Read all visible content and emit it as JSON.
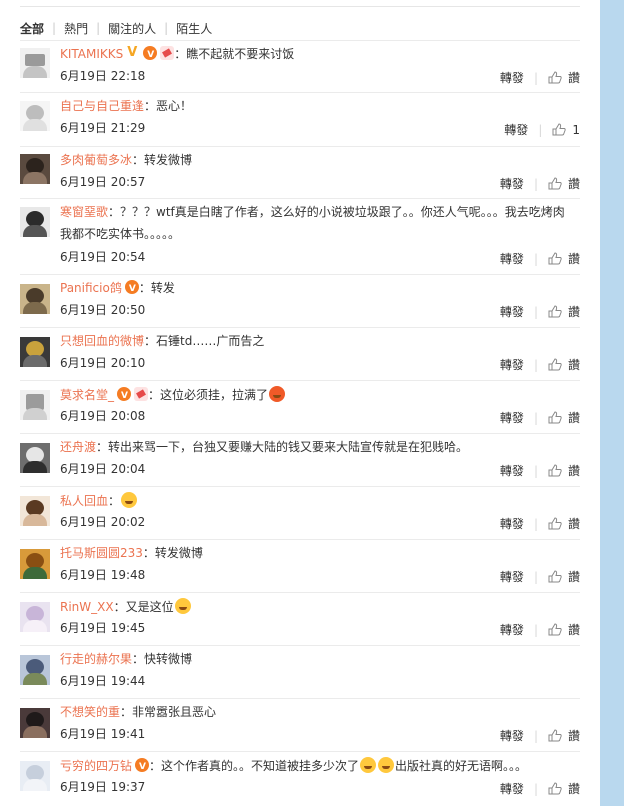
{
  "filter": {
    "tabs": [
      "全部",
      "熱門",
      "關注的人",
      "陌生人"
    ]
  },
  "comments": [
    {
      "name": "KITAMIKKS",
      "text": "：瞧不起就不要来讨饭",
      "date": "6月19日 22:18",
      "repost": "轉發",
      "reply": "讚"
    },
    {
      "name": "自己与自己重逢",
      "text": "：恶心！",
      "date": "6月19日 21:29",
      "repost": "轉發",
      "reply": "1"
    },
    {
      "name": "多肉葡萄多冰",
      "text": "：转发微博",
      "date": "6月19日 20:57",
      "repost": "轉發",
      "reply": "讚"
    },
    {
      "name": "寒窗堊歌",
      "text": "：？？？wtf真是白瞎了作者，这么好的小说被垃圾跟了。。你还人气呢。。。我去吃烤肉",
      "text2": "我都不吃实体书。。。。。",
      "date": "6月19日 20:54",
      "repost": "轉發",
      "reply": "讚"
    },
    {
      "name": "Panificio鸽",
      "text": "：转发",
      "date": "6月19日 20:50",
      "repost": "轉發",
      "reply": "讚"
    },
    {
      "name": "只想回血的微博",
      "text": "：石锤td……广而告之",
      "date": "6月19日 20:10",
      "repost": "轉發",
      "reply": "讚"
    },
    {
      "name": "莫求名堂_",
      "text": "：这位必须挂，拉满了",
      "date": "6月19日 20:08",
      "repost": "轉發",
      "reply": "讚"
    },
    {
      "name": "还舟渡",
      "text": "：转出来骂一下，台独又要赚大陆的钱又要来大陆宣传就是在犯贱哈。",
      "date": "6月19日 20:04",
      "repost": "轉發",
      "reply": "讚"
    },
    {
      "name": "私人回血",
      "text": "：",
      "date": "6月19日 20:02",
      "repost": "轉發",
      "reply": "讚"
    },
    {
      "name": "托马斯圆圆233",
      "text": "：转发微博",
      "date": "6月19日 19:48",
      "repost": "轉發",
      "reply": "讚"
    },
    {
      "name": "RinW_XX",
      "text": "：又是这位",
      "date": "6月19日 19:45",
      "repost": "轉發",
      "reply": "讚"
    },
    {
      "name": "行走的赫尔果",
      "text": "：快转微博",
      "date": "6月19日 19:44",
      "repost": "轉發",
      "reply": "讚"
    },
    {
      "name": "不想笑的重",
      "text": "：非常嚣张且恶心",
      "date": "6月19日 19:41",
      "repost": "轉發",
      "reply": "讚"
    },
    {
      "name": "亏穷的四万钻",
      "text": "：这个作者真的。。不知道被挂多少次了",
      "text_b": "出版社真的好无语啊。。。",
      "date": "6月19日 19:37",
      "repost": "轉發",
      "reply": "讚"
    }
  ]
}
